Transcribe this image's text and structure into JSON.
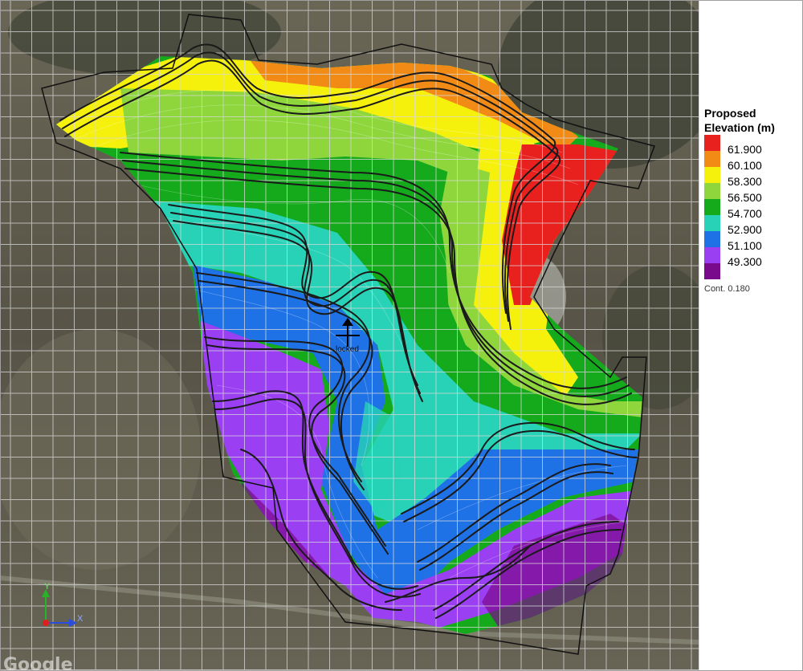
{
  "legend": {
    "title": "Proposed\nElevation (m)",
    "items": [
      {
        "label": "61.900",
        "color": "#e8201e"
      },
      {
        "label": "60.100",
        "color": "#f28a16"
      },
      {
        "label": "58.300",
        "color": "#f5f00c"
      },
      {
        "label": "56.500",
        "color": "#8ed63c"
      },
      {
        "label": "54.700",
        "color": "#15a91c"
      },
      {
        "label": "52.900",
        "color": "#27d2b6"
      },
      {
        "label": "51.100",
        "color": "#1f72e6"
      },
      {
        "label": "49.300",
        "color": "#9a3ff2"
      },
      {
        "label": "",
        "color": "#7a0a8c"
      }
    ],
    "contour_interval": "Cont. 0.180"
  },
  "axes": {
    "x_label": "X",
    "y_label": "Y"
  },
  "marker_label": "locked",
  "attribution": "Google",
  "colors": {
    "satellite": "#5d5a4e",
    "grid": "#d9d9d9",
    "boundary": "#111111",
    "swale": "#1a1a1a"
  }
}
